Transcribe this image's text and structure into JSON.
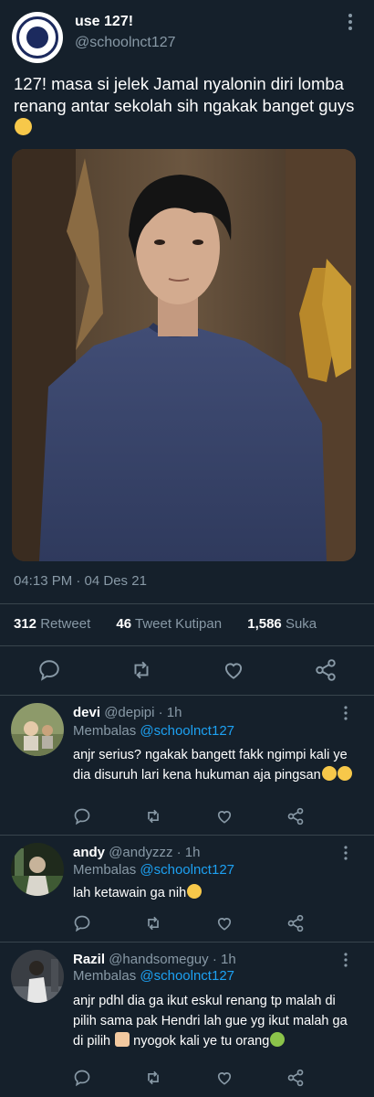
{
  "tweet": {
    "author_name": "use 127!",
    "author_handle": "@schoolnct127",
    "avatar_text": "NCT 127",
    "text": "127! masa si jelek Jamal nyalonin diri lomba renang antar sekolah sih ngakak banget guys",
    "text_emoji": "sob-emoji",
    "timestamp": "04:13 PM · 04 Des 21",
    "stats": {
      "retweets": "312",
      "retweets_label": "Retweet",
      "quotes": "46",
      "quotes_label": "Tweet Kutipan",
      "likes": "1,586",
      "likes_label": "Suka"
    }
  },
  "replies": [
    {
      "name": "devi",
      "handle": "@depipi",
      "time": "· 1h",
      "replying_prefix": "Membalas",
      "replying_to": "@schoolnct127",
      "text": "anjr serius? ngakak bangett fakk ngimpi kali ye dia disuruh lari kena hukuman aja pingsan",
      "emojis": [
        "rofl-emoji",
        "rofl-emoji"
      ]
    },
    {
      "name": "andy",
      "handle": "@andyzzz",
      "time": "· 1h",
      "replying_prefix": "Membalas",
      "replying_to": "@schoolnct127",
      "text": "lah ketawain ga nih",
      "emojis": [
        "rofl-emoji"
      ]
    },
    {
      "name": "Razil",
      "handle": "@handsomeguy",
      "time": "· 1h",
      "replying_prefix": "Membalas",
      "replying_to": "@schoolnct127",
      "text_part1": "anjr pdhl dia ga ikut eskul renang tp malah di pilih sama pak Hendri lah gue yg ikut malah ga di pilih",
      "text_part2": "nyogok kali ye tu orang",
      "emojis": [
        "person-shrugging-emoji",
        "nauseated-face-emoji"
      ]
    }
  ],
  "colors": {
    "background": "#15202b",
    "text_primary": "#ffffff",
    "text_muted": "#8899a6",
    "link": "#1da1f2",
    "divider": "#38444d"
  }
}
